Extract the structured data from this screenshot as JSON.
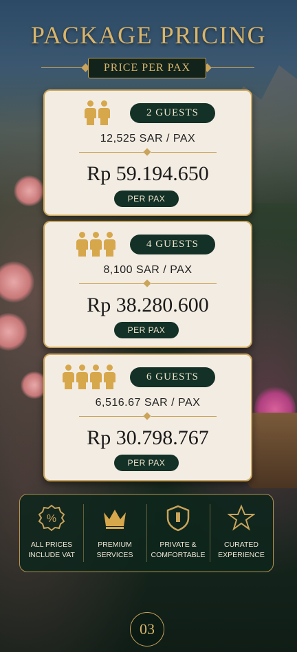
{
  "header": {
    "title": "PACKAGE PRICING",
    "subtitle": "PRICE PER PAX"
  },
  "cards": [
    {
      "guests": "2 GUESTS",
      "people_count": 2,
      "sar": "12,525 SAR / PAX",
      "price": "Rp 59.194.650",
      "per_pax": "PER PAX"
    },
    {
      "guests": "4 GUESTS",
      "people_count": 3,
      "sar": "8,100 SAR / PAX",
      "price": "Rp 38.280.600",
      "per_pax": "PER PAX"
    },
    {
      "guests": "6 GUESTS",
      "people_count": 4,
      "sar": "6,516.67 SAR / PAX",
      "price": "Rp 30.798.767",
      "per_pax": "PER PAX"
    }
  ],
  "features": [
    {
      "icon": "percent-badge-icon",
      "label_1": "ALL PRICES",
      "label_2": "INCLUDE VAT"
    },
    {
      "icon": "crown-icon",
      "label_1": "PREMIUM",
      "label_2": "SERVICES"
    },
    {
      "icon": "shield-icon",
      "label_1": "PRIVATE &",
      "label_2": "COMFORTABLE"
    },
    {
      "icon": "star-icon",
      "label_1": "CURATED",
      "label_2": "EXPERIENCE"
    }
  ],
  "page_number": "03",
  "colors": {
    "gold": "#c9a45a",
    "dark_green": "#133126",
    "card_bg": "#f3ece2"
  }
}
